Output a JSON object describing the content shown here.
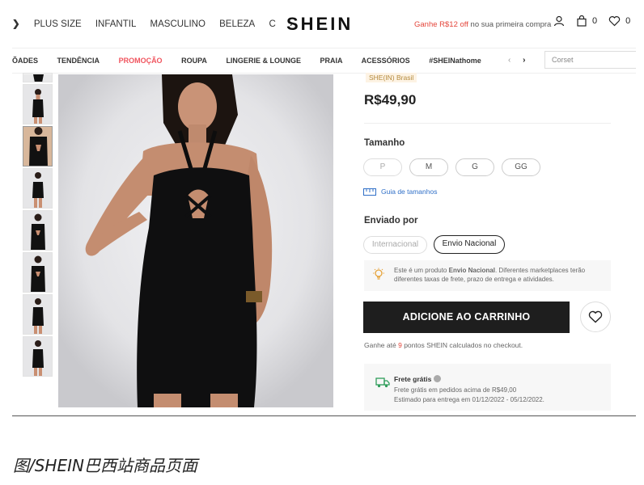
{
  "header": {
    "nav_arrow_left": "❯",
    "nav_items": [
      "PLUS SIZE",
      "INFANTIL",
      "MASCULINO",
      "BELEZA",
      "C"
    ],
    "nav_arrow_right": "›",
    "logo": "SHEIN",
    "promo_highlight": "Ganhe R$12 off",
    "promo_text": "no sua primeira compra",
    "cart_count": "0",
    "wishlist_count": "0"
  },
  "categories": {
    "items": [
      "ÕADES",
      "TENDÊNCIA",
      "PROMOÇÃO",
      "ROUPA",
      "LINGERIE & LOUNGE",
      "PRAIA",
      "ACESSÓRIOS",
      "#SHEINathome"
    ],
    "arrow_prev": "‹",
    "arrow_next": "›",
    "search_placeholder": "Corset"
  },
  "product": {
    "seller_tag": "SHE(IN) Brasil",
    "price": "R$49,90",
    "size_label": "Tamanho",
    "sizes": [
      "P",
      "M",
      "G",
      "GG"
    ],
    "size_guide": "Guia de tamanhos",
    "shipping_label": "Enviado por",
    "ship_options": [
      "Internacional",
      "Envio Nacional"
    ],
    "selected_ship": "Envio Nacional",
    "notice_prefix": "Este é um produto",
    "notice_bold": "Envio Nacional",
    "notice_rest": ". Diferentes marketplaces terão",
    "notice_line2": "diferentes taxas de frete, prazo de entrega e atividades.",
    "add_to_cart": "ADICIONE AO CARRINHO",
    "points_prefix": "Ganhe até",
    "points_value": "9",
    "points_suffix": "pontos SHEIN calculados no checkout.",
    "free_ship_title": "Frete grátis",
    "free_ship_line1": "Frete grátis em pedidos acima de R$49,00",
    "free_ship_line2": "Estimado para entrega em 01/12/2022 - 05/12/2022."
  },
  "caption": "图/SHEIN巴西站商品页面",
  "colors": {
    "accent_red": "#e4453a",
    "category_promo": "#f0545e",
    "cart_button": "#1e1e1e",
    "link_blue": "#2f6fc7",
    "seller_gold": "#b58a3d"
  }
}
